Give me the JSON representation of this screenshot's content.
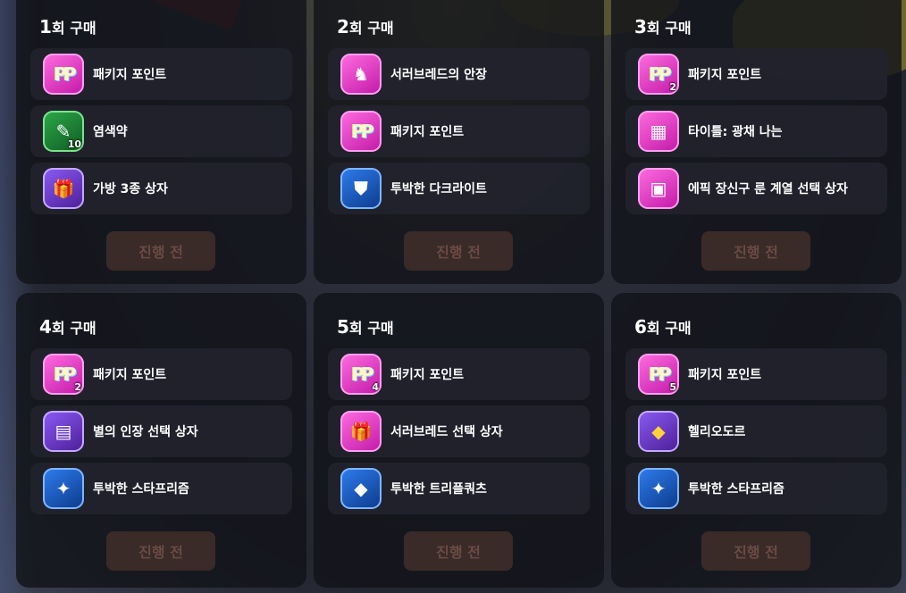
{
  "cards": [
    {
      "title_num": "1",
      "title_suffix": "회 구매",
      "items": [
        {
          "label": "패키지 포인트",
          "icon": "package-point-icon",
          "qty": ""
        },
        {
          "label": "염색약",
          "icon": "dye-potion-icon",
          "qty": "10"
        },
        {
          "label": "가방 3종 상자",
          "icon": "bag-box-icon",
          "qty": ""
        }
      ],
      "status": "진행 전"
    },
    {
      "title_num": "2",
      "title_suffix": "회 구매",
      "items": [
        {
          "label": "서러브레드의 안장",
          "icon": "saddle-icon",
          "qty": ""
        },
        {
          "label": "패키지 포인트",
          "icon": "package-point-icon",
          "qty": ""
        },
        {
          "label": "투박한 다크라이트",
          "icon": "shield-gem-icon",
          "qty": ""
        }
      ],
      "status": "진행 전"
    },
    {
      "title_num": "3",
      "title_suffix": "회 구매",
      "items": [
        {
          "label": "패키지 포인트",
          "icon": "package-point-icon",
          "qty": "2"
        },
        {
          "label": "타이틀: 광채 나는",
          "icon": "title-scroll-icon",
          "qty": ""
        },
        {
          "label": "에픽 장신구 룬 계열 선택 상자",
          "icon": "epic-chest-icon",
          "qty": ""
        }
      ],
      "status": "진행 전"
    },
    {
      "title_num": "4",
      "title_suffix": "회 구매",
      "items": [
        {
          "label": "패키지 포인트",
          "icon": "package-point-icon",
          "qty": "2"
        },
        {
          "label": "별의 인장 선택 상자",
          "icon": "star-seal-box-icon",
          "qty": ""
        },
        {
          "label": "투박한 스타프리즘",
          "icon": "star-prism-icon",
          "qty": ""
        }
      ],
      "status": "진행 전"
    },
    {
      "title_num": "5",
      "title_suffix": "회 구매",
      "items": [
        {
          "label": "패키지 포인트",
          "icon": "package-point-icon",
          "qty": "4"
        },
        {
          "label": "서러브레드 선택 상자",
          "icon": "gift-box-icon",
          "qty": ""
        },
        {
          "label": "투박한 트리플쿼츠",
          "icon": "triple-quartz-icon",
          "qty": ""
        }
      ],
      "status": "진행 전"
    },
    {
      "title_num": "6",
      "title_suffix": "회 구매",
      "items": [
        {
          "label": "패키지 포인트",
          "icon": "package-point-icon",
          "qty": "5"
        },
        {
          "label": "헬리오도르",
          "icon": "heliodor-gem-icon",
          "qty": ""
        },
        {
          "label": "투박한 스타프리즘",
          "icon": "star-prism-icon",
          "qty": ""
        }
      ],
      "status": "진행 전"
    }
  ]
}
